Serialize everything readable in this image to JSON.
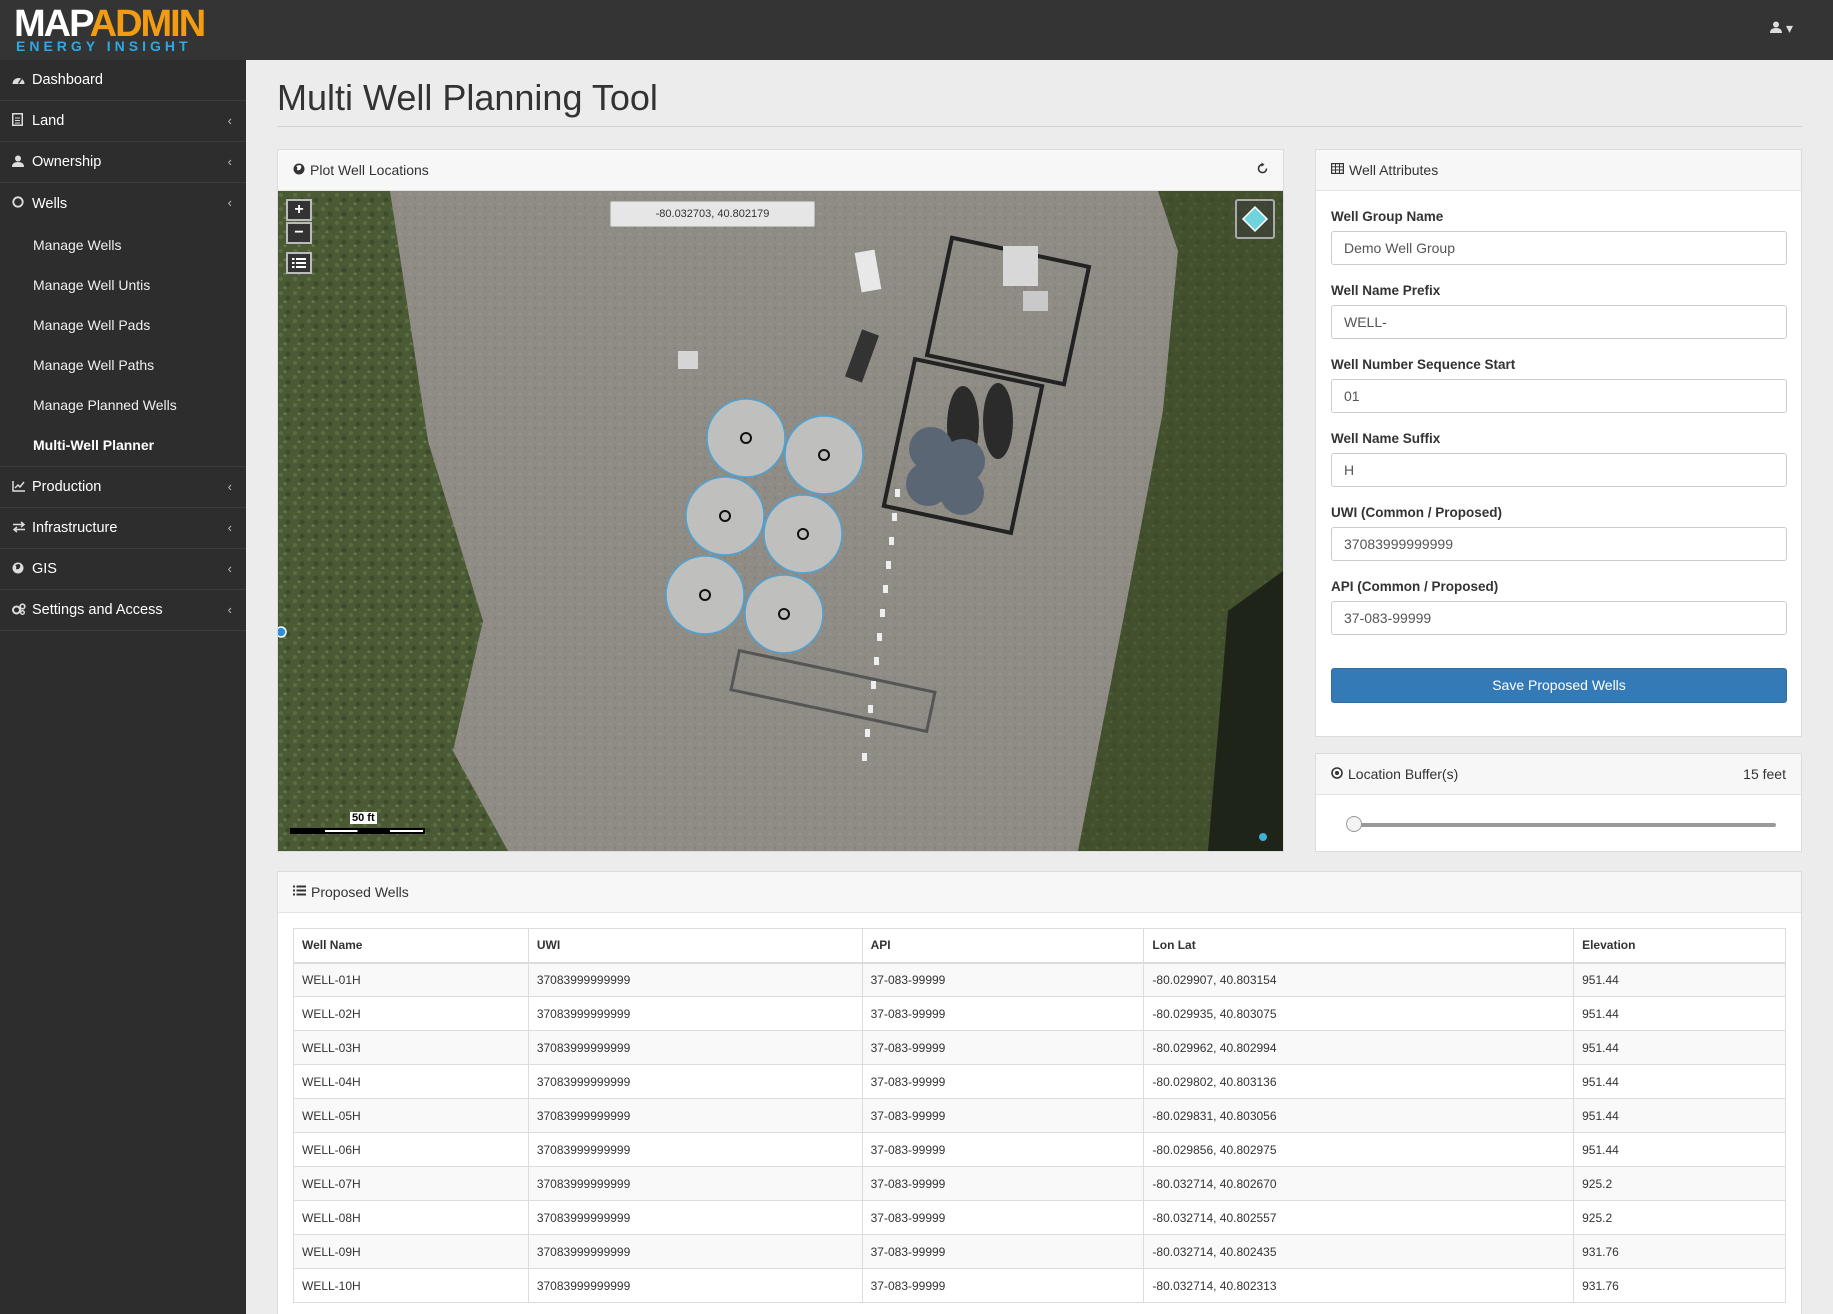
{
  "brand": {
    "logo_map": "MAP",
    "logo_admin": "ADMIN",
    "logo_sub": "ENERGY INSIGHT"
  },
  "user_menu": {
    "icon": "user-icon",
    "caret": "▾"
  },
  "sidebar": {
    "items": [
      {
        "label": "Dashboard",
        "icon": "dashboard-icon"
      },
      {
        "label": "Land",
        "icon": "file-icon"
      },
      {
        "label": "Ownership",
        "icon": "user-icon"
      },
      {
        "label": "Wells",
        "icon": "circle-icon"
      },
      {
        "label": "Production",
        "icon": "line-chart-icon"
      },
      {
        "label": "Infrastructure",
        "icon": "exchange-icon"
      },
      {
        "label": "GIS",
        "icon": "globe-icon"
      },
      {
        "label": "Settings and Access",
        "icon": "cogs-icon"
      }
    ],
    "wells_sub": [
      "Manage Wells",
      "Manage Well Untis",
      "Manage Well Pads",
      "Manage Well Paths",
      "Manage Planned Wells",
      "Multi-Well Planner"
    ]
  },
  "page": {
    "title": "Multi Well Planning Tool"
  },
  "map_panel": {
    "title": "Plot Well Locations",
    "coords": "-80.032703, 40.802179",
    "zoom_in": "+",
    "zoom_out": "−",
    "scale_label": "50 ft"
  },
  "attributes": {
    "title": "Well Attributes",
    "fields": [
      {
        "label": "Well Group Name",
        "value": "Demo Well Group"
      },
      {
        "label": "Well Name Prefix",
        "value": "WELL-"
      },
      {
        "label": "Well Number Sequence Start",
        "value": "01"
      },
      {
        "label": "Well Name Suffix",
        "value": "H"
      },
      {
        "label": "UWI (Common / Proposed)",
        "value": "37083999999999"
      },
      {
        "label": "API (Common / Proposed)",
        "value": "37-083-99999"
      }
    ],
    "save_label": "Save Proposed Wells"
  },
  "buffer": {
    "title": "Location Buffer(s)",
    "value_text": "15 feet",
    "level": 0.0
  },
  "wells_table": {
    "title": "Proposed Wells",
    "columns": [
      "Well Name",
      "UWI",
      "API",
      "Lon Lat",
      "Elevation"
    ],
    "rows": [
      [
        "WELL-01H",
        "37083999999999",
        "37-083-99999",
        "-80.029907, 40.803154",
        "951.44"
      ],
      [
        "WELL-02H",
        "37083999999999",
        "37-083-99999",
        "-80.029935, 40.803075",
        "951.44"
      ],
      [
        "WELL-03H",
        "37083999999999",
        "37-083-99999",
        "-80.029962, 40.802994",
        "951.44"
      ],
      [
        "WELL-04H",
        "37083999999999",
        "37-083-99999",
        "-80.029802, 40.803136",
        "951.44"
      ],
      [
        "WELL-05H",
        "37083999999999",
        "37-083-99999",
        "-80.029831, 40.803056",
        "951.44"
      ],
      [
        "WELL-06H",
        "37083999999999",
        "37-083-99999",
        "-80.029856, 40.802975",
        "951.44"
      ],
      [
        "WELL-07H",
        "37083999999999",
        "37-083-99999",
        "-80.032714, 40.802670",
        "925.2"
      ],
      [
        "WELL-08H",
        "37083999999999",
        "37-083-99999",
        "-80.032714, 40.802557",
        "925.2"
      ],
      [
        "WELL-09H",
        "37083999999999",
        "37-083-99999",
        "-80.032714, 40.802435",
        "931.76"
      ],
      [
        "WELL-10H",
        "37083999999999",
        "37-083-99999",
        "-80.032714, 40.802313",
        "931.76"
      ]
    ]
  },
  "colors": {
    "brand_orange": "#f39c12",
    "brand_blue": "#2ea8e5",
    "primary": "#337ab7",
    "sidebar": "#2d2d2d"
  }
}
